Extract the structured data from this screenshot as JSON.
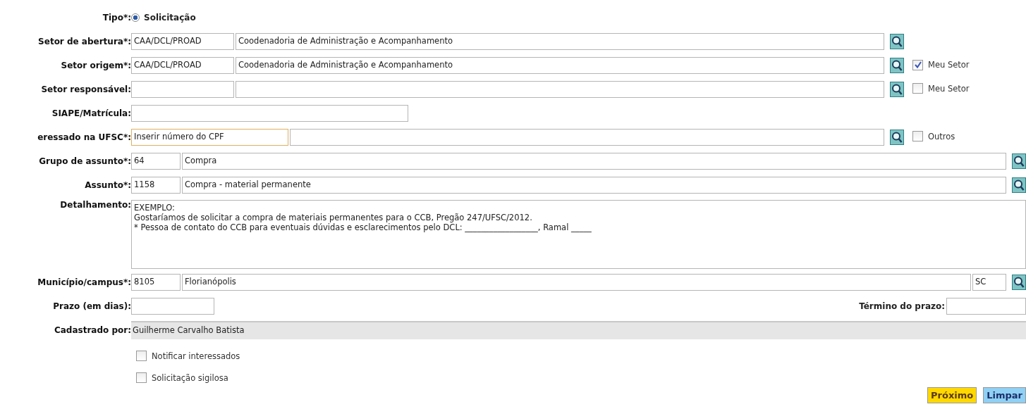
{
  "form": {
    "rows": [
      {
        "kind": "radio",
        "label": "Tipo*:",
        "options": [
          {
            "label": "Solicitação",
            "selected": true
          }
        ]
      },
      {
        "kind": "sector",
        "label": "Setor de abertura*:",
        "code": "CAA/DCL/PROAD",
        "name": "Coodenadoria de Administração e Acompanhamento"
      },
      {
        "kind": "sector",
        "label": "Setor origem*:",
        "code": "CAA/DCL/PROAD",
        "name": "Coodenadoria de Administração e Acompanhamento",
        "option": {
          "label": "Meu Setor",
          "checked": true
        }
      },
      {
        "kind": "sector",
        "label": "Setor responsável:",
        "option": {
          "label": "Meu Setor",
          "checked": false
        }
      },
      {
        "kind": "text",
        "label": "SIAPE/Matrícula:"
      },
      {
        "kind": "person",
        "label": "eressado na UFSC*:",
        "value": "Inserir número do CPF",
        "option": {
          "label": "Outros",
          "checked": false
        }
      },
      {
        "kind": "subject",
        "label": "Grupo de assunto*:",
        "code": "64",
        "name": "Compra"
      },
      {
        "kind": "subject",
        "label": "Assunto*:",
        "code": "1158",
        "name": "Compra - material permanente"
      },
      {
        "kind": "textarea",
        "label": "Detalhamento:",
        "value": "EXEMPLO:\nGostaríamos de solicitar a compra de materiais permanentes para o CCB, Pregão 247/UFSC/2012.\n* Pessoa de contato do CCB para eventuais dúvidas e esclarecimentos pelo DCL: __________________, Ramal _____"
      },
      {
        "kind": "city",
        "label": "Município/campus*:",
        "code": "8105",
        "name": "Florianópolis",
        "state": "SC"
      },
      {
        "kind": "deadline",
        "label": "Prazo (em dias):",
        "end_label": "Término do prazo:"
      },
      {
        "kind": "readonly",
        "label": "Cadastrado por:",
        "value": "Guilherme Carvalho Batista"
      }
    ],
    "options": [
      {
        "label": "Notificar interessados",
        "checked": false
      },
      {
        "label": "Solicitação sigilosa",
        "checked": false
      }
    ],
    "buttons": [
      {
        "label": "Próximo",
        "kind": "primary"
      },
      {
        "label": "Limpar",
        "kind": "secondary"
      }
    ]
  }
}
